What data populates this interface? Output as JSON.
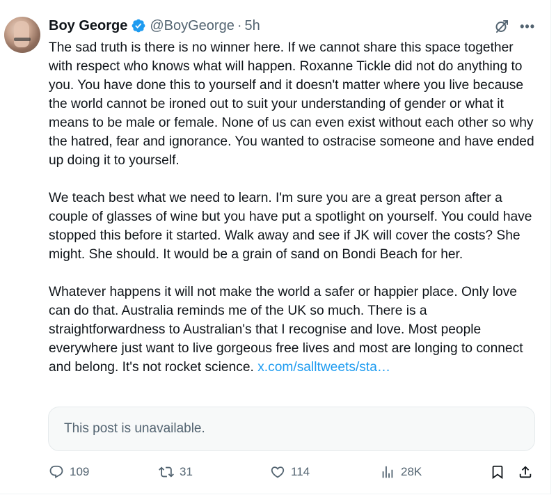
{
  "author": {
    "name": "Boy George",
    "handle": "@BoyGeorge",
    "separator": "·",
    "time": "5h"
  },
  "tweet": {
    "paragraphs": [
      "The sad truth is there is no winner here. If we cannot share this space together with respect who knows what will happen. Roxanne Tickle did not do anything to you. You have done this to yourself and it doesn't matter where you live because the world cannot be ironed out to suit your understanding of gender or what it means to be male or female. None of us can even exist without each other so why the hatred, fear and ignorance. You wanted to ostracise someone and have ended up doing it to yourself.",
      "We teach best what we need to learn. I'm sure you are a great person after a couple of glasses of wine but you have put a spotlight on yourself. You could have stopped this before it started. Walk away and see if JK will cover the costs? She might. She should. It would be a grain of sand on Bondi Beach for her.",
      "Whatever happens it will not make the world a safer or happier place. Only love can do that. Australia reminds me of the UK so much. There is a straightforwardness to Australian's that I recognise and love. Most people everywhere just want to live gorgeous free lives and most are longing to connect and belong. It's not rocket science."
    ],
    "link_text": "x.com/salltweets/sta…"
  },
  "quote": {
    "unavailable_text": "This post is unavailable."
  },
  "actions": {
    "replies": "109",
    "reposts": "31",
    "likes": "114",
    "views": "28K"
  },
  "icons": {
    "verified": "verified-badge-icon",
    "grok": "grok-icon",
    "more": "more-icon",
    "reply": "reply-icon",
    "repost": "repost-icon",
    "like": "like-icon",
    "views": "views-icon",
    "bookmark": "bookmark-icon",
    "share": "share-icon"
  },
  "colors": {
    "text": "#0f1419",
    "secondary": "#536471",
    "link": "#1d9bf0",
    "verified": "#1d9bf0",
    "quote_bg": "#f7f9f9"
  }
}
